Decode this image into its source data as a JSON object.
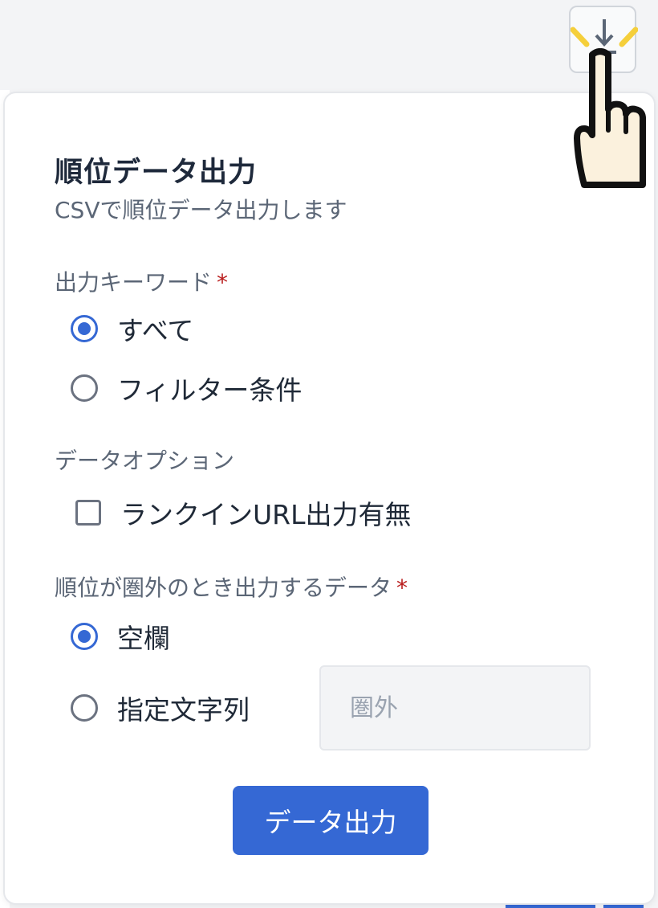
{
  "toolbar": {
    "download_icon": "download-icon",
    "pointer_icon": "pointing-hand-icon"
  },
  "popover": {
    "title": "順位データ出力",
    "subtitle": "CSVで順位データ出力します",
    "keyword_section": {
      "label": "出力キーワード",
      "required_mark": "*",
      "options": [
        {
          "label": "すべて",
          "checked": true
        },
        {
          "label": "フィルター条件",
          "checked": false
        }
      ]
    },
    "data_option_section": {
      "label": "データオプション",
      "checkbox_label": "ランクインURL出力有無",
      "checked": false
    },
    "out_of_rank_section": {
      "label": "順位が圏外のとき出力するデータ",
      "required_mark": "*",
      "options": [
        {
          "label": "空欄",
          "checked": true
        },
        {
          "label": "指定文字列",
          "checked": false
        }
      ],
      "input_placeholder": "圏外",
      "input_value": ""
    },
    "submit_label": "データ出力"
  },
  "colors": {
    "accent": "#3568d4",
    "required": "#b91c1c",
    "highlight": "#f5cf3b"
  }
}
